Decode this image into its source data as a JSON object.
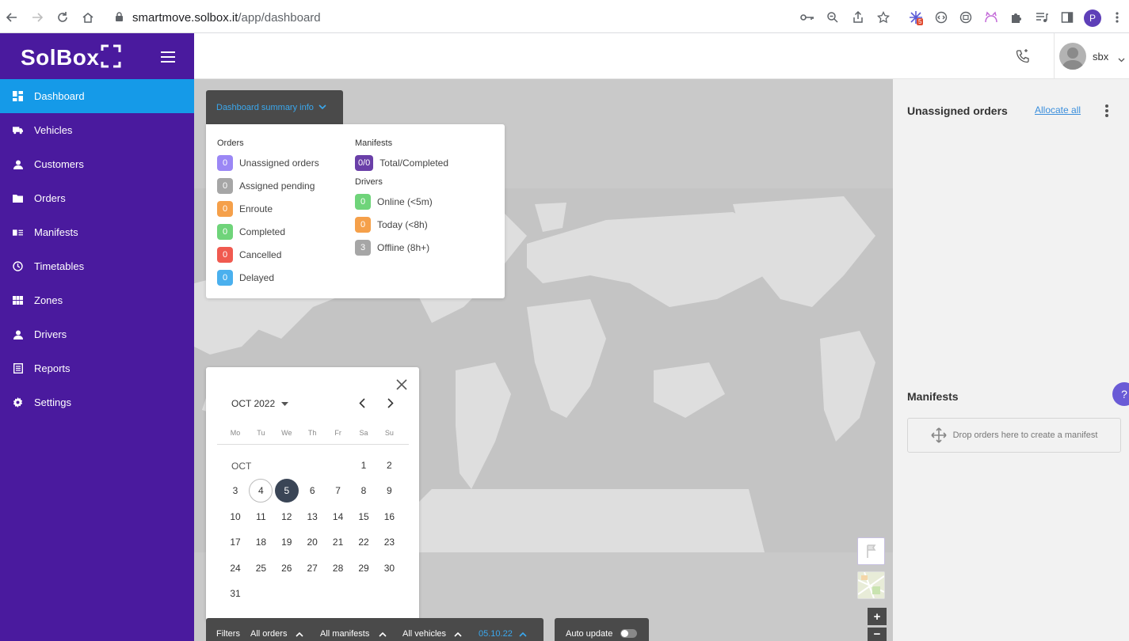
{
  "browser": {
    "url_host": "smartmove.solbox.it",
    "url_path": "/app/dashboard",
    "profile_initial": "P",
    "extension_badge": "5"
  },
  "brand": {
    "logo_text": "SolBox",
    "sidebar_color": "#4a1a9e",
    "active_color": "#159ae8"
  },
  "sidebar": {
    "items": [
      {
        "label": "Dashboard",
        "icon": "dashboard-icon",
        "active": true
      },
      {
        "label": "Vehicles",
        "icon": "truck-icon"
      },
      {
        "label": "Customers",
        "icon": "person-icon"
      },
      {
        "label": "Orders",
        "icon": "folder-icon"
      },
      {
        "label": "Manifests",
        "icon": "manifest-icon"
      },
      {
        "label": "Timetables",
        "icon": "clock-icon"
      },
      {
        "label": "Zones",
        "icon": "grid-icon"
      },
      {
        "label": "Drivers",
        "icon": "person-icon"
      },
      {
        "label": "Reports",
        "icon": "report-icon"
      },
      {
        "label": "Settings",
        "icon": "gear-icon"
      }
    ]
  },
  "header": {
    "username": "sbx"
  },
  "summary": {
    "tab_label": "Dashboard summary info",
    "orders_heading": "Orders",
    "orders": [
      {
        "value": "0",
        "label": "Unassigned orders",
        "color": "#9b87f5"
      },
      {
        "value": "0",
        "label": "Assigned pending",
        "color": "#a6a6a6"
      },
      {
        "value": "0",
        "label": "Enroute",
        "color": "#f5a04a"
      },
      {
        "value": "0",
        "label": "Completed",
        "color": "#6fd47a"
      },
      {
        "value": "0",
        "label": "Cancelled",
        "color": "#f05a50"
      },
      {
        "value": "0",
        "label": "Delayed",
        "color": "#4ab0ee"
      }
    ],
    "manifests_heading": "Manifests",
    "manifests": [
      {
        "value": "0/0",
        "label": "Total/Completed",
        "color": "#6a3fa8"
      }
    ],
    "drivers_heading": "Drivers",
    "drivers": [
      {
        "value": "0",
        "label": "Online (<5m)",
        "color": "#6fd47a"
      },
      {
        "value": "0",
        "label": "Today (<8h)",
        "color": "#f5a04a"
      },
      {
        "value": "3",
        "label": "Offline (8h+)",
        "color": "#a6a6a6"
      }
    ]
  },
  "calendar": {
    "month_label": "OCT 2022",
    "month_short": "OCT",
    "weekdays": [
      "Mo",
      "Tu",
      "We",
      "Th",
      "Fr",
      "Sa",
      "Su"
    ],
    "first_weekday_index": 5,
    "days_in_month": 31,
    "today": 4,
    "selected": 5
  },
  "filters": {
    "label": "Filters",
    "orders": "All orders",
    "manifests": "All manifests",
    "vehicles": "All vehicles",
    "date": "05.10.22",
    "auto_update": "Auto update"
  },
  "right_panel": {
    "unassigned_title": "Unassigned orders",
    "allocate_all": "Allocate all",
    "manifests_title": "Manifests",
    "dropzone_text": "Drop orders here to create a manifest"
  }
}
